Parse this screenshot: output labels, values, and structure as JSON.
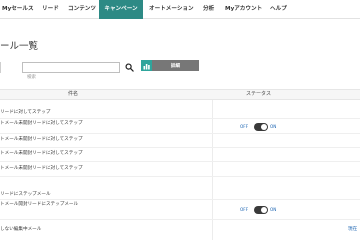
{
  "nav": {
    "items": [
      {
        "label": "Myセールス"
      },
      {
        "label": "リード"
      },
      {
        "label": "コンテンツ"
      },
      {
        "label": "キャンペーン",
        "active": true
      },
      {
        "label": "オートメーション"
      },
      {
        "label": "分析"
      },
      {
        "label": "Myアカウント"
      },
      {
        "label": "ヘルプ"
      }
    ],
    "active_color": "#2d8a85"
  },
  "page": {
    "title": "ール一覧"
  },
  "search": {
    "value": "",
    "placeholder": "検索",
    "icon": "search-icon"
  },
  "detail_button": {
    "label": "詳細",
    "icon": "chart-icon",
    "icon_color": "#2fa59c"
  },
  "table": {
    "columns": [
      "件名",
      "ステータス"
    ],
    "rows": [
      {
        "name": "リードに対してステップ",
        "toggle": null
      },
      {
        "name": "トメール未開封リードに対してステップ",
        "toggle": {
          "off": "OFF",
          "on": "ON"
        }
      },
      {
        "name": "トメール未開封リードに対してステップ",
        "toggle": null
      },
      {
        "name": "トメール未開封リードに対してステップ",
        "toggle": null
      },
      {
        "name": "トメール未開封リードに対してステップ",
        "toggle": null
      },
      {
        "name": "リードにステップメール",
        "toggle": null
      },
      {
        "name": "トメール開封リードにステップメール",
        "toggle": {
          "off": "OFF",
          "on": "ON"
        }
      },
      {
        "name": "しない編集中メール",
        "toggle": null
      }
    ]
  },
  "footer": {
    "link": "現在"
  }
}
